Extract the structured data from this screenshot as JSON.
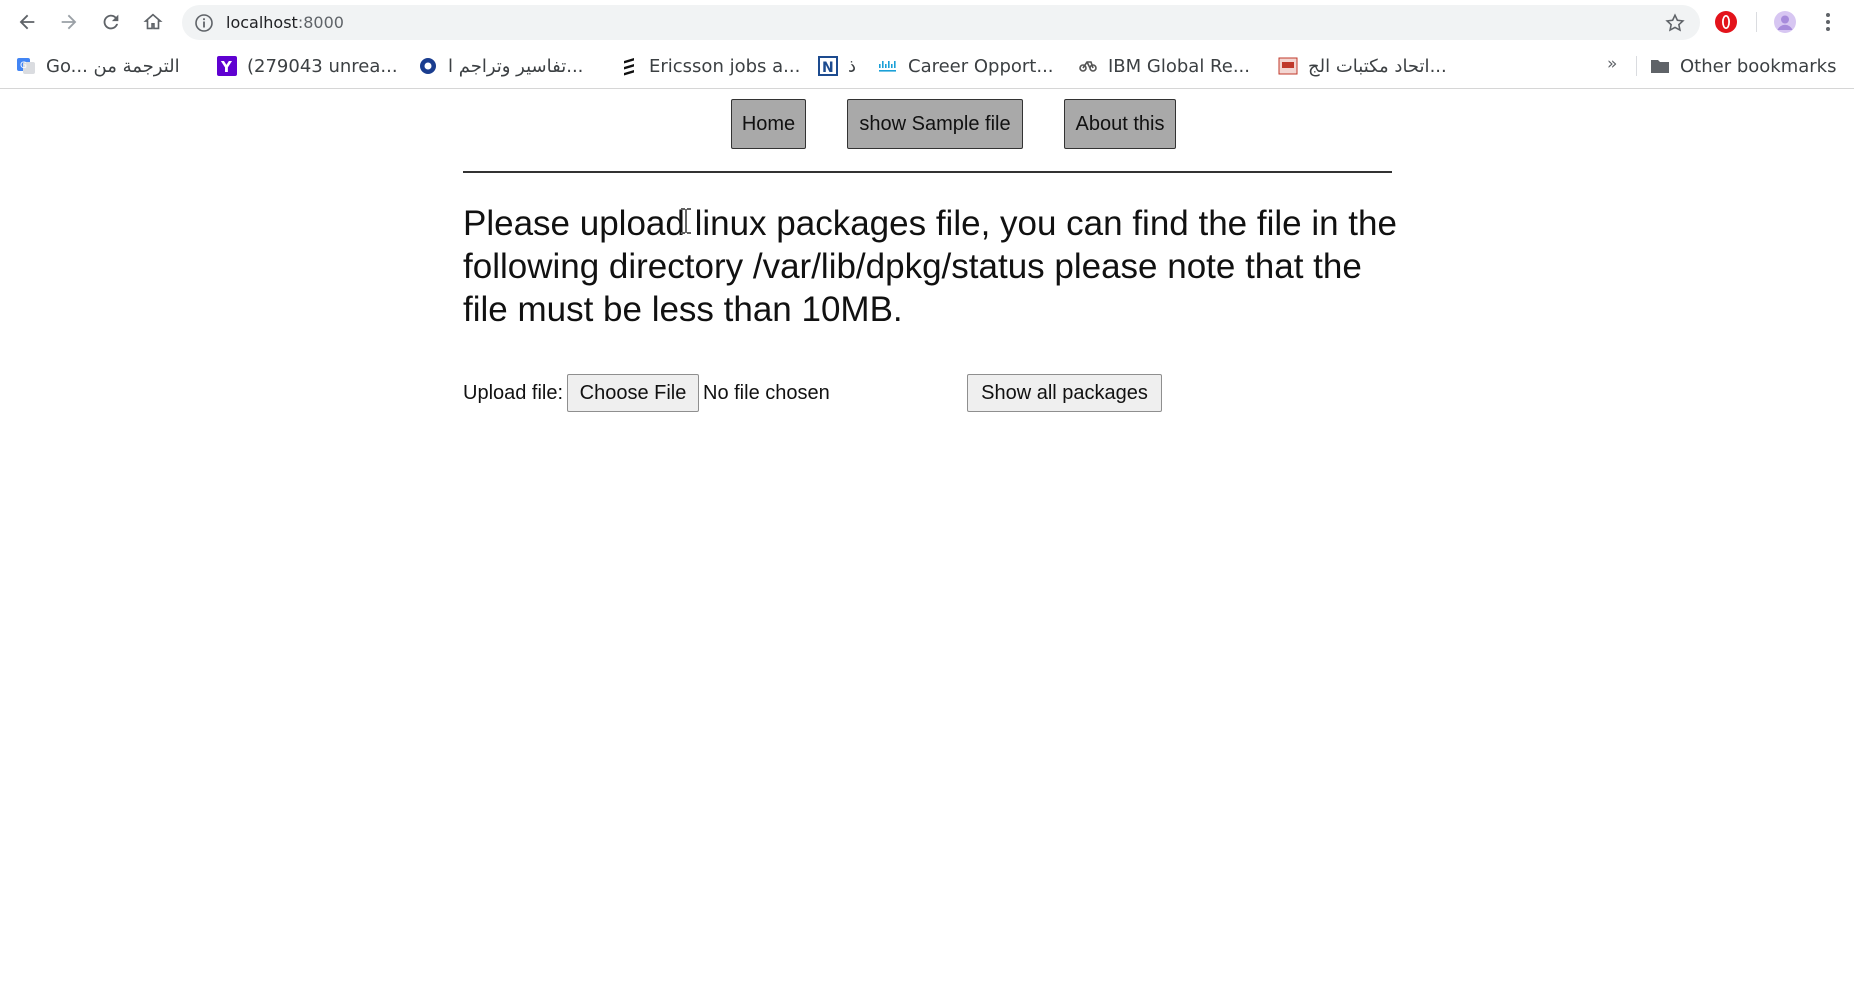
{
  "browser": {
    "url_host": "localhost",
    "url_port": ":8000",
    "bookmarks": [
      {
        "label": "Go... الترجمة من",
        "icon": "google-translate-icon",
        "color": "#4285f4"
      },
      {
        "label": "(279043 unrea...",
        "icon": "yahoo-icon",
        "color": "#5f01d1"
      },
      {
        "label": "تفاسير وتراجم ا...",
        "icon": "gear-site-icon",
        "color": "#1a3d8f"
      },
      {
        "label": "Ericsson jobs a...",
        "icon": "ericsson-icon",
        "color": "#111111"
      },
      {
        "label": "ذ",
        "icon": "n-site-icon",
        "color": "#1d4b8f"
      },
      {
        "label": "Career Opport...",
        "icon": "cisco-icon",
        "color": "#1ba0d7"
      },
      {
        "label": "IBM Global Re...",
        "icon": "ibm-icon",
        "color": "#555555"
      },
      {
        "label": "اتحاد مكتبات الج...",
        "icon": "library-icon",
        "color": "#c0392b"
      }
    ],
    "more_label": "»",
    "other_bookmarks": "Other bookmarks"
  },
  "nav": {
    "home": "Home",
    "sample": "show Sample file",
    "about": "About this"
  },
  "main": {
    "intro": "Please upload linux packages file, you can find the file in the following directory /var/lib/dpkg/status please note that the file must be less than 10MB.",
    "upload_label": "Upload file:",
    "choose_file": "Choose File",
    "no_file": "No file chosen",
    "show_all": "Show all packages"
  }
}
